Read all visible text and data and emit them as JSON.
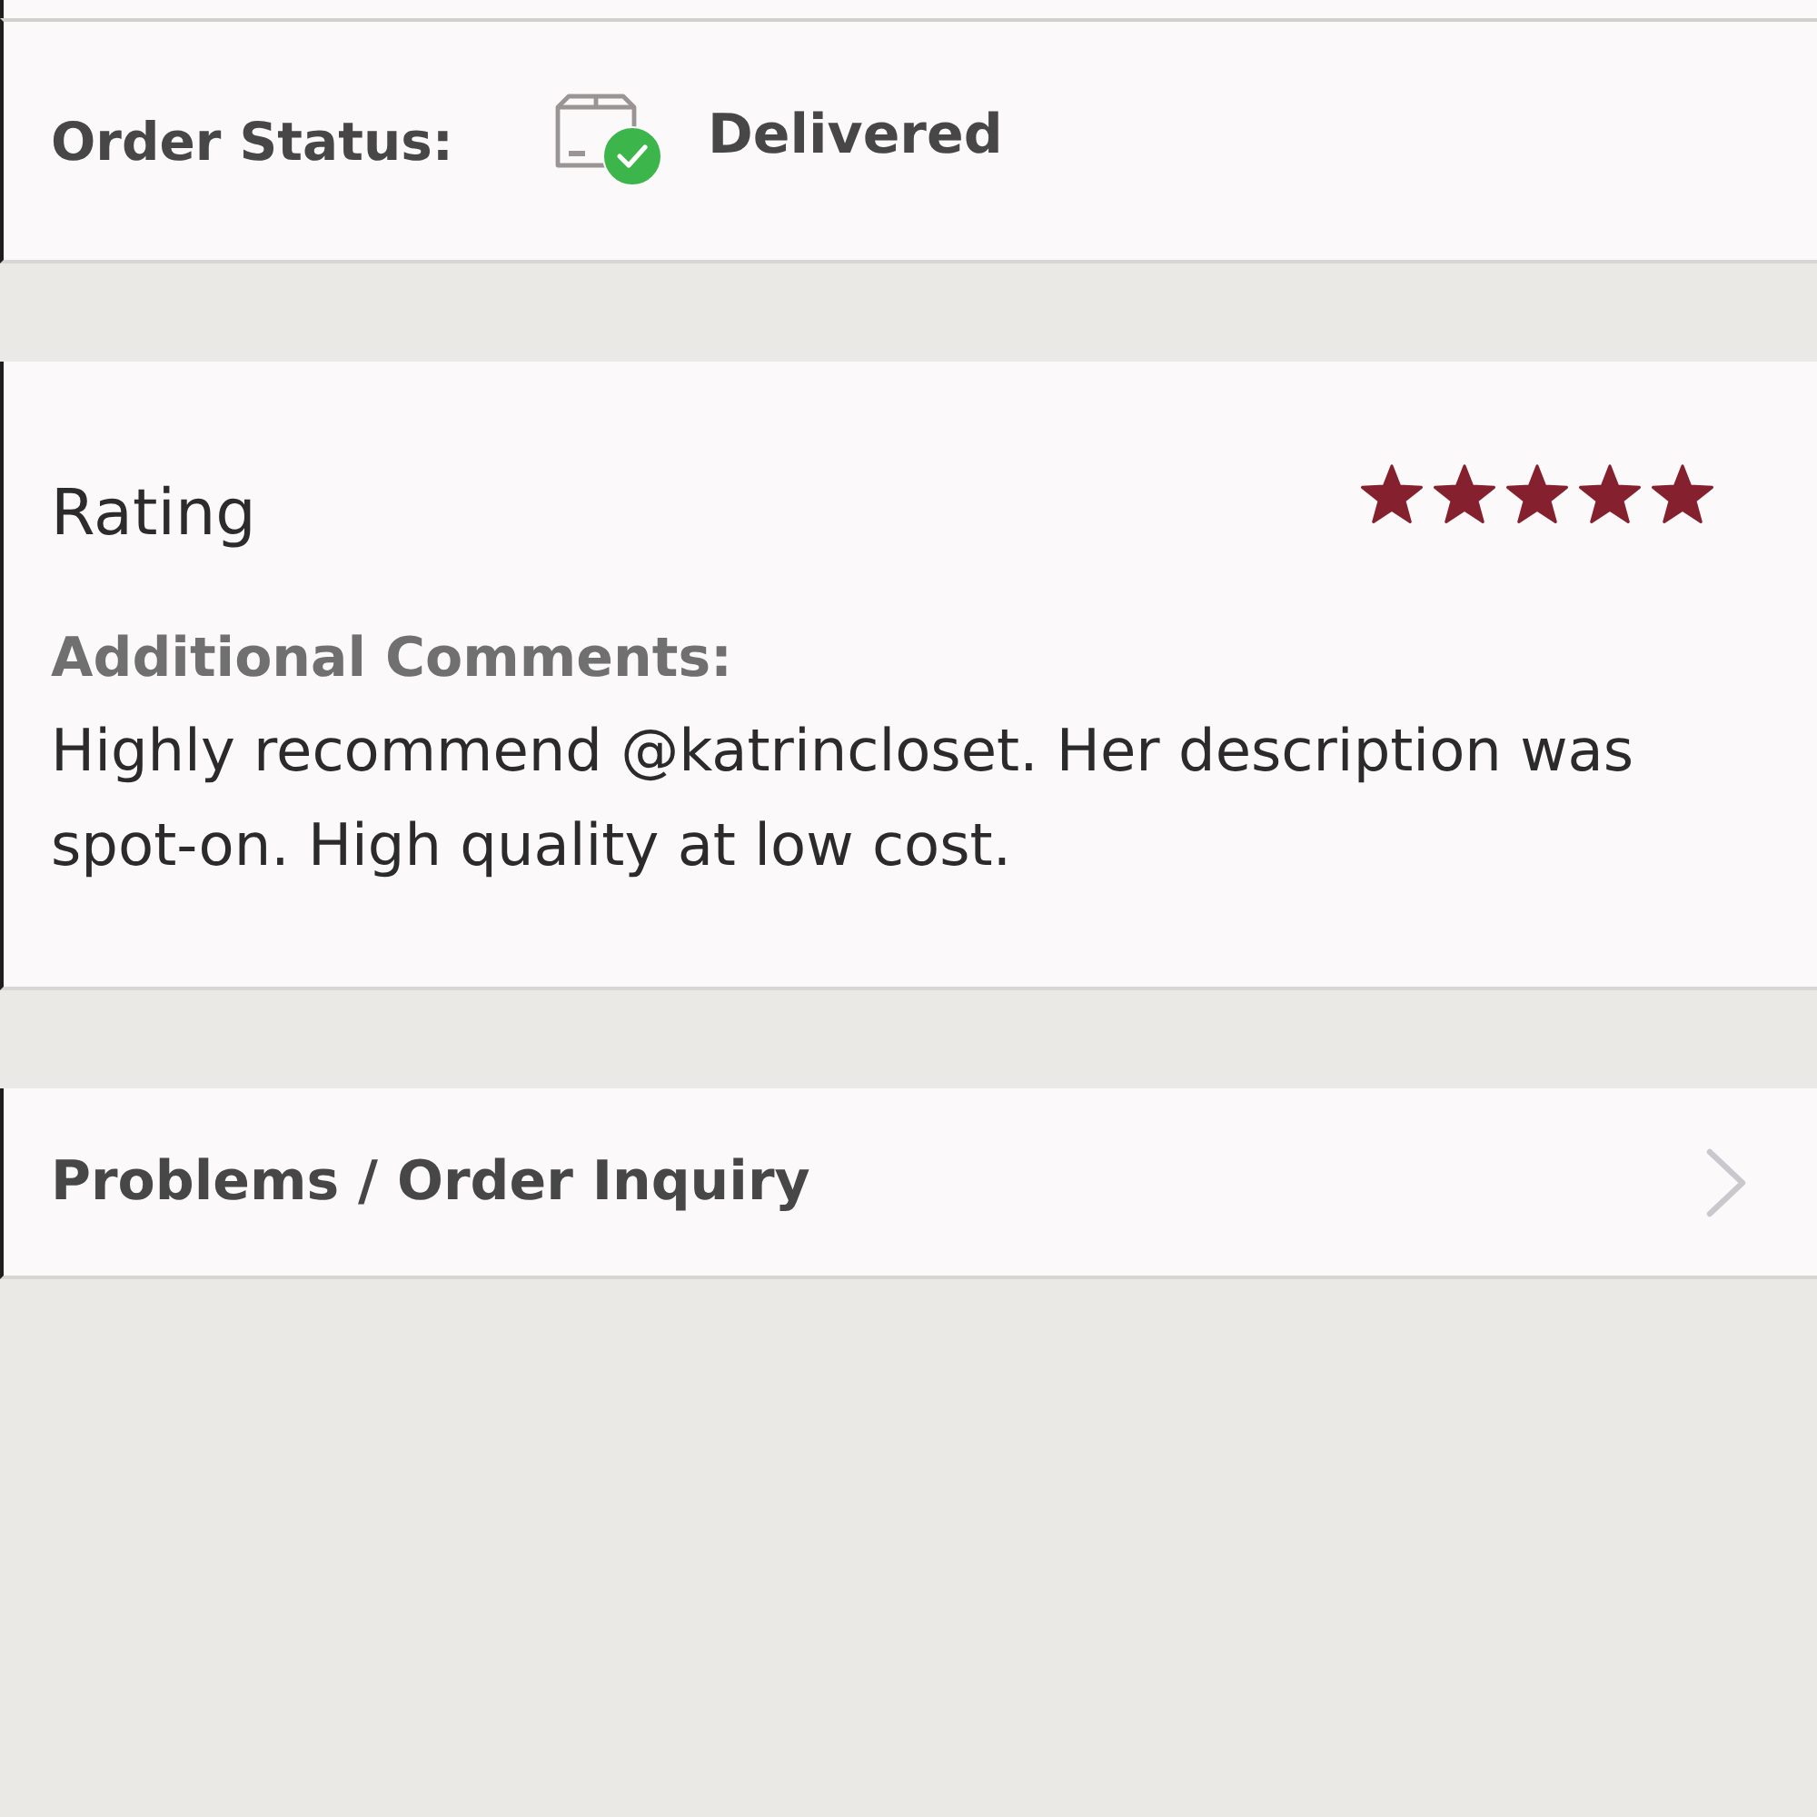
{
  "order_status": {
    "label": "Order Status:",
    "value": "Delivered"
  },
  "rating": {
    "title": "Rating",
    "stars": 5,
    "comments_label": "Additional Comments:",
    "comments": "Highly recommend @katrincloset. Her description was spot-on. High quality at low cost."
  },
  "inquiry_link": {
    "label": "Problems / Order Inquiry"
  }
}
